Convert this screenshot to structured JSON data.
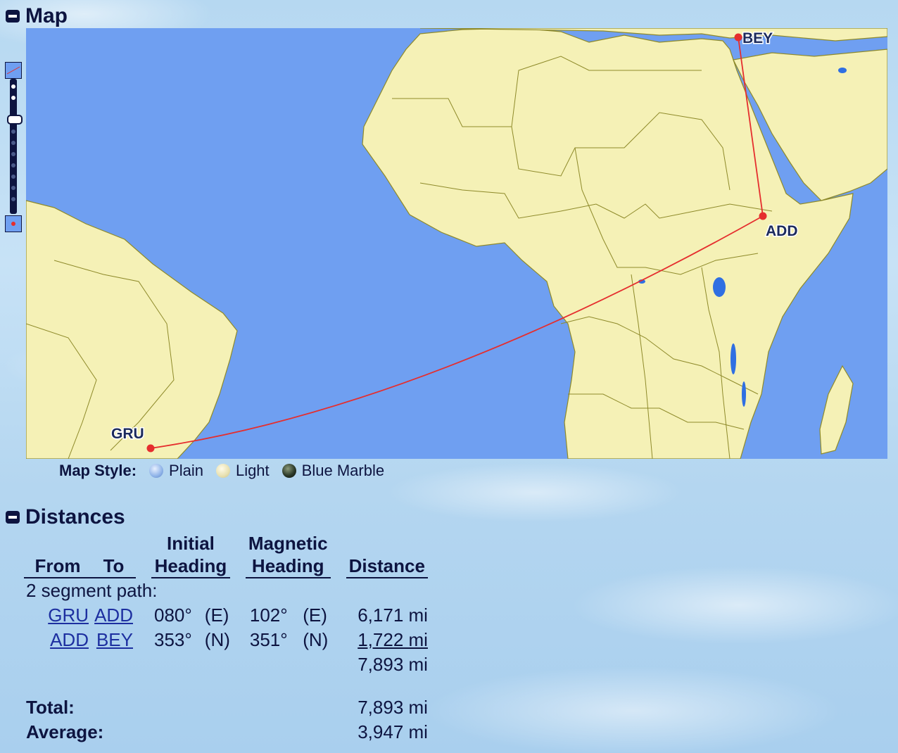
{
  "map_section": {
    "title": "Map"
  },
  "map": {
    "airports": [
      {
        "code": "BEY"
      },
      {
        "code": "ADD"
      },
      {
        "code": "GRU"
      }
    ],
    "route_color": "#e52e2e",
    "ocean_color": "#6f9ff1",
    "land_color": "#f5f1b6",
    "border_color": "#8e8a2a"
  },
  "map_style": {
    "label": "Map Style:",
    "options": [
      {
        "label": "Plain",
        "icon": "globe-plain-icon"
      },
      {
        "label": "Light",
        "icon": "globe-light-icon"
      },
      {
        "label": "Blue Marble",
        "icon": "globe-blue-marble-icon"
      }
    ]
  },
  "distances_section": {
    "title": "Distances"
  },
  "distances": {
    "headers": {
      "from": "From",
      "to": "To",
      "initial_top": "Initial",
      "initial_bottom": "Heading",
      "magnetic_top": "Magnetic",
      "magnetic_bottom": "Heading",
      "distance": "Distance"
    },
    "path_label": "2 segment path:",
    "segments": [
      {
        "from": "GRU",
        "to": "ADD",
        "initial": "080°",
        "initial_dir": "(E)",
        "magnetic": "102°",
        "magnetic_dir": "(E)",
        "distance": "6,171 mi"
      },
      {
        "from": "ADD",
        "to": "BEY",
        "initial": "353°",
        "initial_dir": "(N)",
        "magnetic": "351°",
        "magnetic_dir": "(N)",
        "distance": "1,722 mi"
      }
    ],
    "path_total": "7,893 mi",
    "total_label": "Total:",
    "total_value": "7,893 mi",
    "average_label": "Average:",
    "average_value": "3,947 mi"
  }
}
